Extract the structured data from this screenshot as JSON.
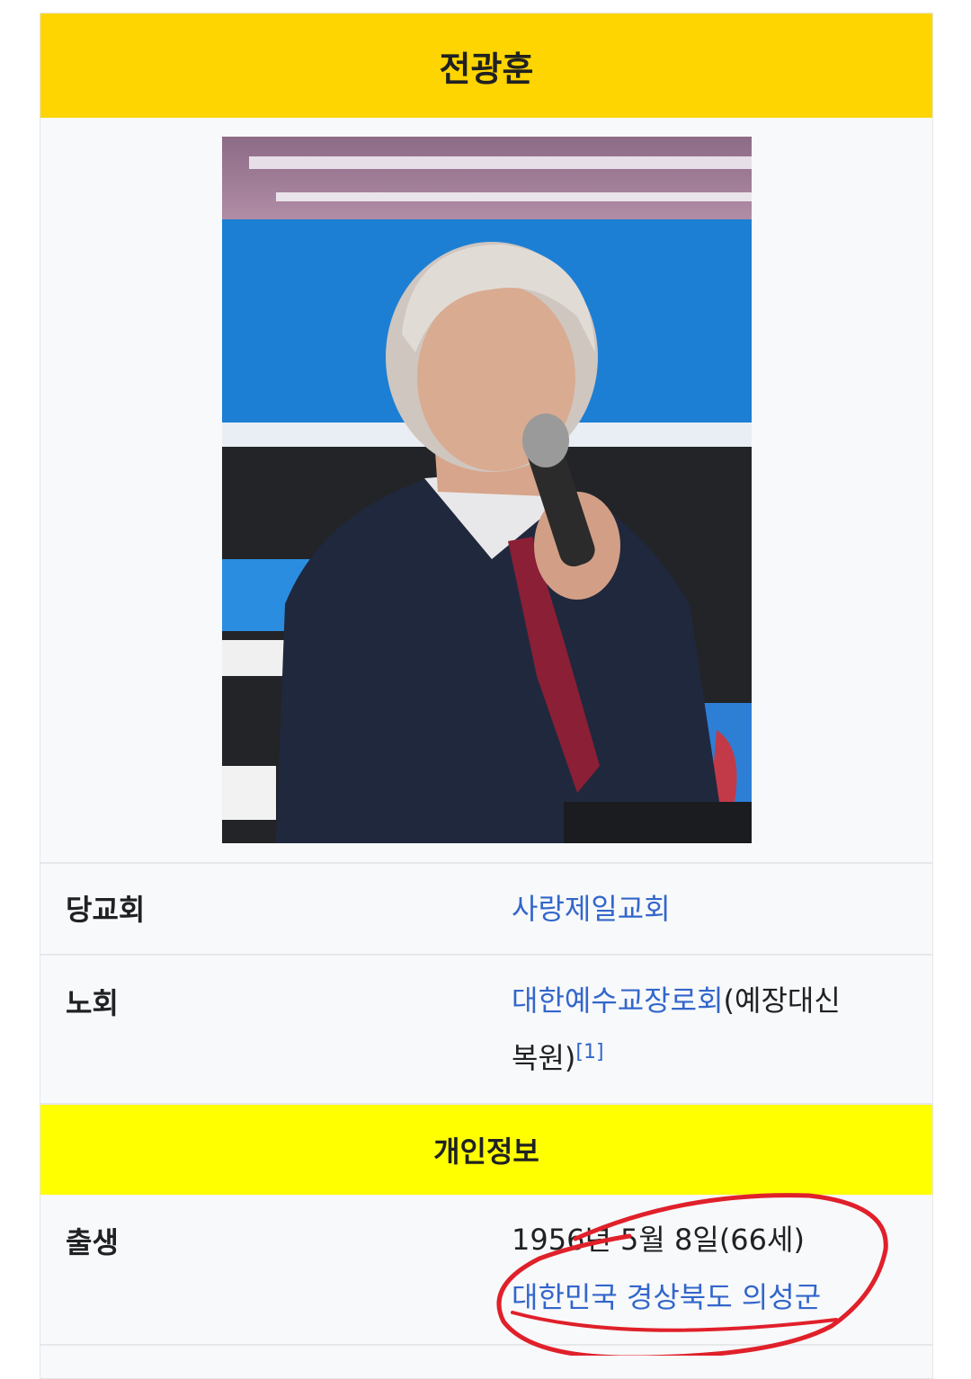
{
  "infobox": {
    "title": "전광훈",
    "photo_icon": "portrait-photo",
    "rows": [
      {
        "label": "당교회",
        "link": "사랑제일교회"
      },
      {
        "label": "노회",
        "link": "대한예수교장로회",
        "text_a": "(예장대신",
        "text_b": "복원)",
        "ref": "[1]"
      }
    ],
    "section_header": "개인정보",
    "birth": {
      "label": "출생",
      "date": "1956년 5월 8일(66세)",
      "place_link": "대한민국 경상북도 의성군"
    }
  },
  "colors": {
    "title_bg": "#fed500",
    "section_bg": "#ffff00",
    "link": "#3366cc",
    "annotation_circle": "#e0202a"
  }
}
